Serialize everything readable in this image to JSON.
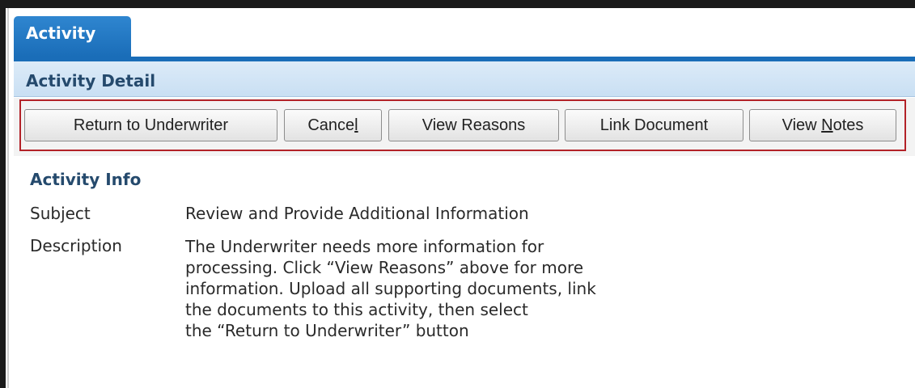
{
  "tab": {
    "label": "Activity"
  },
  "header": {
    "title": "Activity Detail"
  },
  "toolbar": {
    "return_to_underwriter": "Return to Underwriter",
    "cancel_prefix": "Cance",
    "cancel_accel": "l",
    "view_reasons": "View Reasons",
    "link_document": "Link Document",
    "view_notes_prefix": "View ",
    "view_notes_accel": "N",
    "view_notes_suffix": "otes",
    "highlight_color": "#b32228"
  },
  "activity_info": {
    "title": "Activity Info",
    "subject_label": "Subject",
    "subject_value": "Review and Provide Additional Information",
    "description_label": "Description",
    "description_lines": [
      "The Underwriter needs more information for",
      "processing. Click “View Reasons” above for more",
      "information. Upload all supporting documents, link",
      "the documents to this activity, then select",
      "the “Return to Underwriter” button"
    ]
  },
  "colors": {
    "tab_blue": "#1a6db8",
    "header_bg": "#c9dff3",
    "header_text": "#254a6d"
  }
}
